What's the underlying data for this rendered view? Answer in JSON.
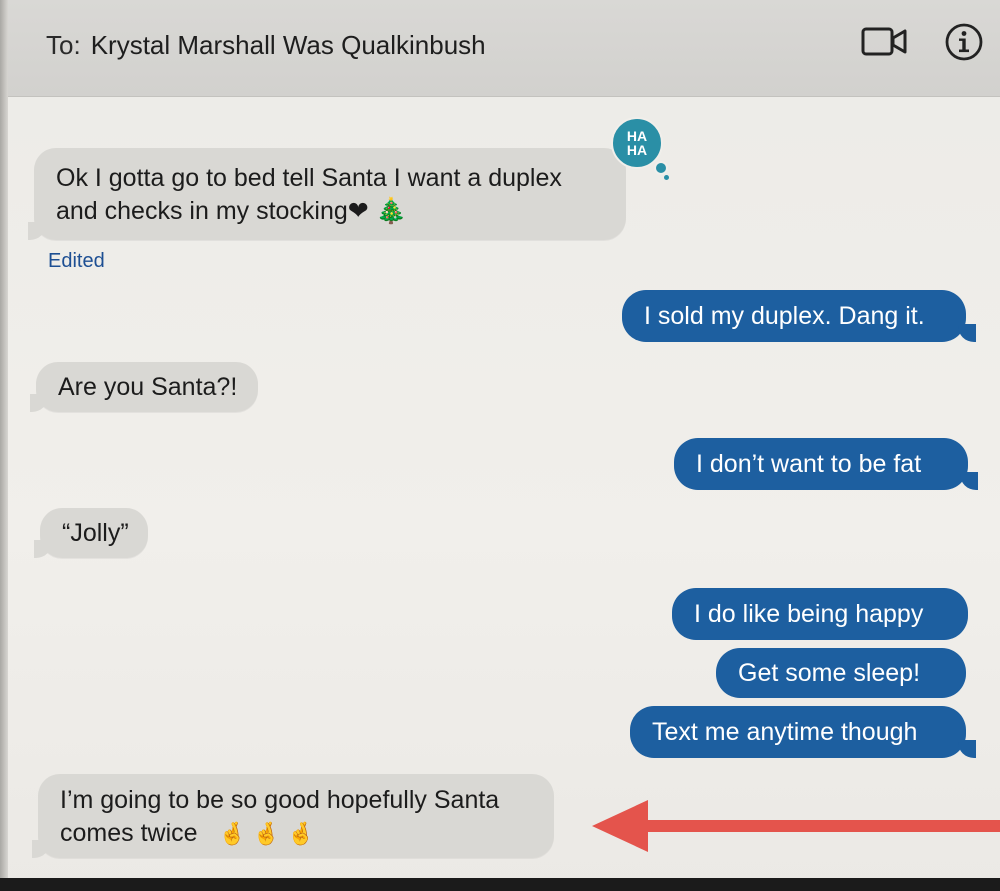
{
  "header": {
    "to_label": "To:",
    "recipient": "Krystal Marshall Was Qualkinbush",
    "video_icon": "video-camera-icon",
    "info_icon": "info-icon"
  },
  "messages": [
    {
      "id": "m1",
      "direction": "incoming",
      "lines": [
        "Ok I gotta go to bed tell Santa I want a duplex",
        "and checks in my stocking❤ 🎄"
      ],
      "reaction": "HA HA",
      "status": "Edited"
    },
    {
      "id": "m2",
      "direction": "outgoing",
      "text": "I sold my duplex. Dang it."
    },
    {
      "id": "m3",
      "direction": "incoming",
      "text": "Are you Santa?!"
    },
    {
      "id": "m4",
      "direction": "outgoing",
      "text": "I don’t want to be fat"
    },
    {
      "id": "m5",
      "direction": "incoming",
      "text": "“Jolly”"
    },
    {
      "id": "m6",
      "direction": "outgoing",
      "text": "I do like being happy"
    },
    {
      "id": "m7",
      "direction": "outgoing",
      "text": "Get some sleep!"
    },
    {
      "id": "m8",
      "direction": "outgoing",
      "text": "Text me anytime though"
    },
    {
      "id": "m9",
      "direction": "incoming",
      "lines": [
        "I’m going to be so good hopefully Santa",
        "comes twice"
      ],
      "emoji": "🤞 🤞 🤞"
    }
  ],
  "reaction_label_top": "HA",
  "reaction_label_bottom": "HA",
  "colors": {
    "incoming_bubble": "#d9d8d4",
    "outgoing_bubble": "#1d5fa0",
    "annotation_arrow": "#e4544c",
    "reaction_badge": "#2a8fa6"
  }
}
